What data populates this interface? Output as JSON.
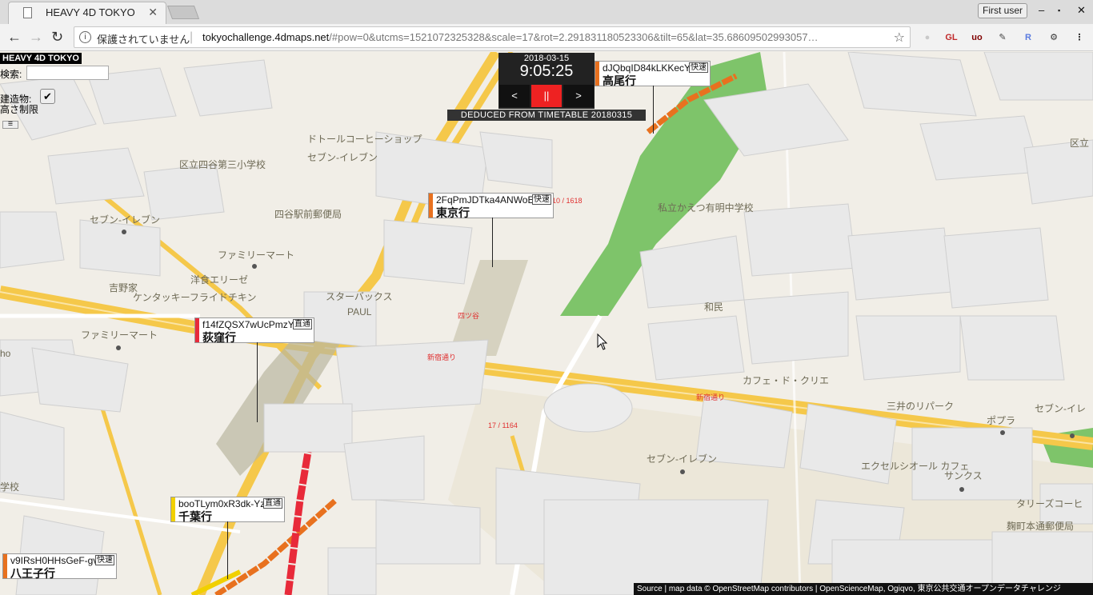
{
  "browser": {
    "tab_title": "HEAVY 4D TOKYO",
    "tab_close": "✕",
    "user_label": "First user",
    "win_minimize": "‒",
    "win_maximize": "▪",
    "win_close": "✕",
    "back": "←",
    "forward": "→",
    "reload": "↻",
    "security_text": "保護されていません",
    "url_host": "tokyochallenge.4dmaps.net",
    "url_rest": "/#pow=0&utcms=1521072325328&scale=17&rot=2.291831180523306&tilt=65&lat=35.68609502993057…",
    "star": "☆",
    "extensions": [
      {
        "name": "ext-grey-icon",
        "label": "●",
        "color": "#c9c9c9"
      },
      {
        "name": "ext-gl-icon",
        "label": "GL",
        "color": "#c0292a"
      },
      {
        "name": "ext-ublock-icon",
        "label": "uo",
        "color": "#800000"
      },
      {
        "name": "ext-eyedropper-icon",
        "label": "✎",
        "color": "#444"
      },
      {
        "name": "ext-r-icon",
        "label": "R",
        "color": "#5a7be0"
      },
      {
        "name": "ext-tool-icon",
        "label": "⚙",
        "color": "#333"
      },
      {
        "name": "ext-menu-icon",
        "label": "⋮",
        "color": "#333"
      }
    ]
  },
  "app": {
    "title": "HEAVY 4D TOKYO",
    "search_label": "検索:",
    "building_label": "建造物:\n高さ制限",
    "building_checked": "✔",
    "small_button": "☰",
    "time": {
      "date": "2018-03-15",
      "clock": "9:05:25",
      "prev": "<",
      "pause": "||",
      "next": ">"
    },
    "deduced": "DEDUCED FROM TIMETABLE 20180315",
    "source": "Source | map data © OpenStreetMap contributors | OpenScienceMap, Ogiqvo, 東京公共交通オープンデータチャレンジ"
  },
  "trains": [
    {
      "id": "dJQbqID84kLKKecY",
      "dest": "高尾行",
      "kind": "快速",
      "color": "#e8711f"
    },
    {
      "id": "2FqPmJDTka4ANWoE",
      "dest": "東京行",
      "kind": "快速",
      "color": "#e8711f"
    },
    {
      "id": "f14fZQSX7wUcPmzY",
      "dest": "荻窪行",
      "kind": "直通",
      "color": "#e82a3a"
    },
    {
      "id": "booTLym0xR3dk-Yz",
      "dest": "千葉行",
      "kind": "直通",
      "color": "#f1d000"
    },
    {
      "id": "v9IRsH0HHsGeF-gv",
      "dest": "八王子行",
      "kind": "快速",
      "color": "#e8711f"
    }
  ],
  "map_labels": [
    {
      "name": "label-doutor",
      "text": "ドトールコーヒーショップ"
    },
    {
      "name": "label-seven-1",
      "text": "セブン-イレブン"
    },
    {
      "name": "label-yotsuya-school",
      "text": "区立四谷第三小学校"
    },
    {
      "name": "label-seven-2",
      "text": "セブン-イレブン"
    },
    {
      "name": "label-post",
      "text": "四谷駅前郵便局"
    },
    {
      "name": "label-familymart-1",
      "text": "ファミリーマート"
    },
    {
      "name": "label-yoshinoya",
      "text": "吉野家"
    },
    {
      "name": "label-youshoku",
      "text": "洋食エリーゼ"
    },
    {
      "name": "label-kfc",
      "text": "ケンタッキーフライドチキン"
    },
    {
      "name": "label-starbucks",
      "text": "スターバックス"
    },
    {
      "name": "label-paul",
      "text": "PAUL"
    },
    {
      "name": "label-familymart-2",
      "text": "ファミリーマート"
    },
    {
      "name": "label-ho",
      "text": "ho"
    },
    {
      "name": "label-school-left",
      "text": "学校"
    },
    {
      "name": "label-kaetsu",
      "text": "私立かえつ有明中学校"
    },
    {
      "name": "label-wamin",
      "text": "和民"
    },
    {
      "name": "label-cafe-crie",
      "text": "カフェ・ド・クリエ"
    },
    {
      "name": "label-mitsui",
      "text": "三井のリパーク"
    },
    {
      "name": "label-poplar",
      "text": "ポプラ"
    },
    {
      "name": "label-seven-3",
      "text": "セブン-イレ"
    },
    {
      "name": "label-seven-4",
      "text": "セブン-イレブン"
    },
    {
      "name": "label-excelsior",
      "text": "エクセルシオール カフェ"
    },
    {
      "name": "label-sankus",
      "text": "サンクス"
    },
    {
      "name": "label-tullys",
      "text": "タリーズコーヒ"
    },
    {
      "name": "label-kojimachi-post",
      "text": "麹町本通郵便局"
    },
    {
      "name": "label-kuritsu",
      "text": "区立"
    }
  ],
  "red_labels": [
    {
      "name": "label-yotsuya-station",
      "text": "四ツ谷"
    },
    {
      "name": "label-shinjuku-dori-1",
      "text": "新宿通り"
    },
    {
      "name": "label-shinjuku-dori-2",
      "text": "新宿通り"
    },
    {
      "name": "label-road-num-1",
      "text": "17 / 1164"
    },
    {
      "name": "label-road-num-2",
      "text": "10 / 1618"
    }
  ]
}
